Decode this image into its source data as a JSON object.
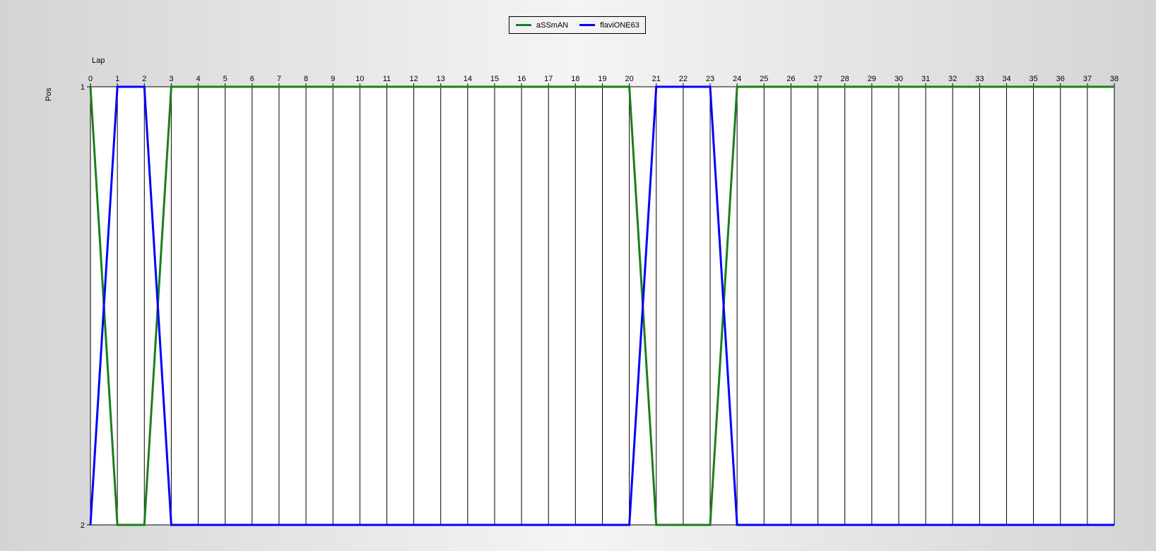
{
  "chart_data": {
    "type": "line",
    "title": "",
    "xlabel": "Lap",
    "ylabel": "Pos",
    "x": [
      0,
      1,
      2,
      3,
      4,
      5,
      6,
      7,
      8,
      9,
      10,
      11,
      12,
      13,
      14,
      15,
      16,
      17,
      18,
      19,
      20,
      21,
      22,
      23,
      24,
      25,
      26,
      27,
      28,
      29,
      30,
      31,
      32,
      33,
      34,
      35,
      36,
      37,
      38
    ],
    "xlim": [
      0,
      38
    ],
    "ylim": [
      1,
      2
    ],
    "y_ticks": [
      1,
      2
    ],
    "y_inverted": true,
    "grid": "vertical",
    "legend_position": "top-center",
    "series": [
      {
        "name": "aSSmAN",
        "color": "#1a7f1a",
        "values": [
          1,
          2,
          2,
          1,
          1,
          1,
          1,
          1,
          1,
          1,
          1,
          1,
          1,
          1,
          1,
          1,
          1,
          1,
          1,
          1,
          1,
          2,
          2,
          2,
          1,
          1,
          1,
          1,
          1,
          1,
          1,
          1,
          1,
          1,
          1,
          1,
          1,
          1,
          1
        ]
      },
      {
        "name": "flaviONE63",
        "color": "#0000ff",
        "values": [
          2,
          1,
          1,
          2,
          2,
          2,
          2,
          2,
          2,
          2,
          2,
          2,
          2,
          2,
          2,
          2,
          2,
          2,
          2,
          2,
          2,
          1,
          1,
          1,
          2,
          2,
          2,
          2,
          2,
          2,
          2,
          2,
          2,
          2,
          2,
          2,
          2,
          2,
          2
        ]
      }
    ]
  }
}
